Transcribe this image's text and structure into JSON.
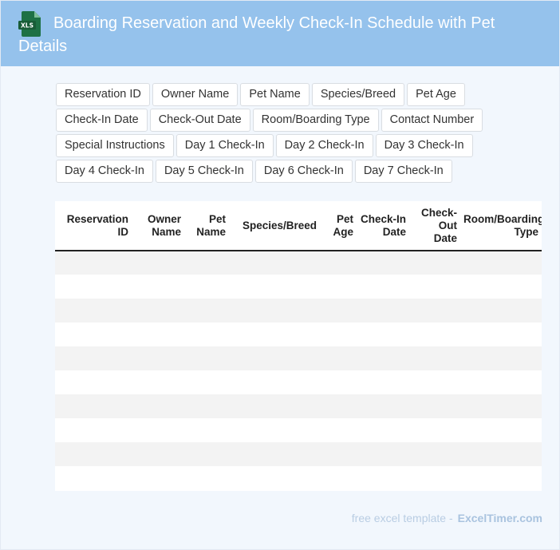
{
  "header": {
    "icon": "xls-file-icon",
    "icon_label": "XLS",
    "title": "Boarding Reservation and Weekly Check-In Schedule with Pet Details",
    "color": "#95c2ec"
  },
  "tags": [
    "Reservation ID",
    "Owner Name",
    "Pet Name",
    "Species/Breed",
    "Pet Age",
    "Check-In Date",
    "Check-Out Date",
    "Room/Boarding Type",
    "Contact Number",
    "Special Instructions",
    "Day 1 Check-In",
    "Day 2 Check-In",
    "Day 3 Check-In",
    "Day 4 Check-In",
    "Day 5 Check-In",
    "Day 6 Check-In",
    "Day 7 Check-In"
  ],
  "table": {
    "columns": [
      "Reservation ID",
      "Owner Name",
      "Pet Name",
      "Species/Breed",
      "Pet Age",
      "Check-In Date",
      "Check-Out Date",
      "Room/Boarding Type"
    ],
    "row_count": 10
  },
  "footer": {
    "text": "free excel template -",
    "brand": "ExcelTimer.com"
  }
}
